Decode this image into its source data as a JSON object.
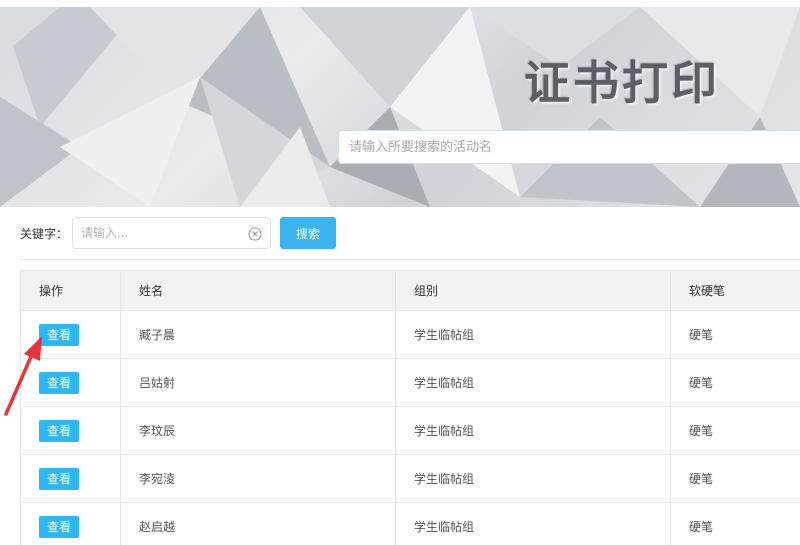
{
  "banner": {
    "title": "证书打印",
    "search_placeholder": "请输入所要搜索的活动名"
  },
  "filter": {
    "keyword_label": "关键字：",
    "keyword_placeholder": "请输入...",
    "keyword_value": "",
    "search_button": "搜索"
  },
  "table": {
    "columns": [
      "操作",
      "姓名",
      "组别",
      "软硬笔"
    ],
    "rows": [
      {
        "action": "查看",
        "name": "臧子晨",
        "group": "学生临帖组",
        "pen": "硬笔"
      },
      {
        "action": "查看",
        "name": "吕姑射",
        "group": "学生临帖组",
        "pen": "硬笔"
      },
      {
        "action": "查看",
        "name": "李玟辰",
        "group": "学生临帖组",
        "pen": "硬笔"
      },
      {
        "action": "查看",
        "name": "李宛淩",
        "group": "学生临帖组",
        "pen": "硬笔"
      },
      {
        "action": "查看",
        "name": "赵启越",
        "group": "学生临帖组",
        "pen": "硬笔"
      }
    ]
  },
  "colors": {
    "accent": "#2db7f5",
    "annotation_arrow": "#e8333a"
  },
  "icons": {
    "clear": "circle-x-icon",
    "annotation": "red-arrow-icon"
  }
}
